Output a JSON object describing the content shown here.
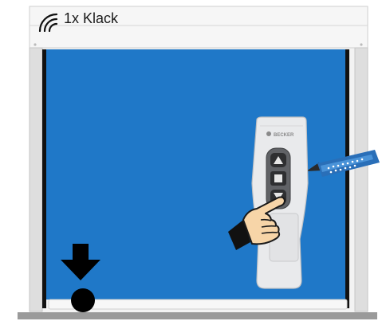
{
  "sound": {
    "label": "1x Klack",
    "icon": "sound-waves-icon"
  },
  "remote": {
    "brand": "BECKER",
    "buttons": [
      "up-triangle-icon",
      "stop-square-icon",
      "down-triangle-icon"
    ],
    "body_color": "#e9eaec"
  },
  "screen": {
    "fabric_color": "#1f78c8",
    "frame_color": "#dcdcdc",
    "side_rail_color": "#111111"
  },
  "indicators": {
    "direction_icon": "arrow-down-icon",
    "end_position_icon": "dot-icon",
    "pointer_icon": "pointing-hand-icon",
    "tool_icon": "pen-icon"
  }
}
